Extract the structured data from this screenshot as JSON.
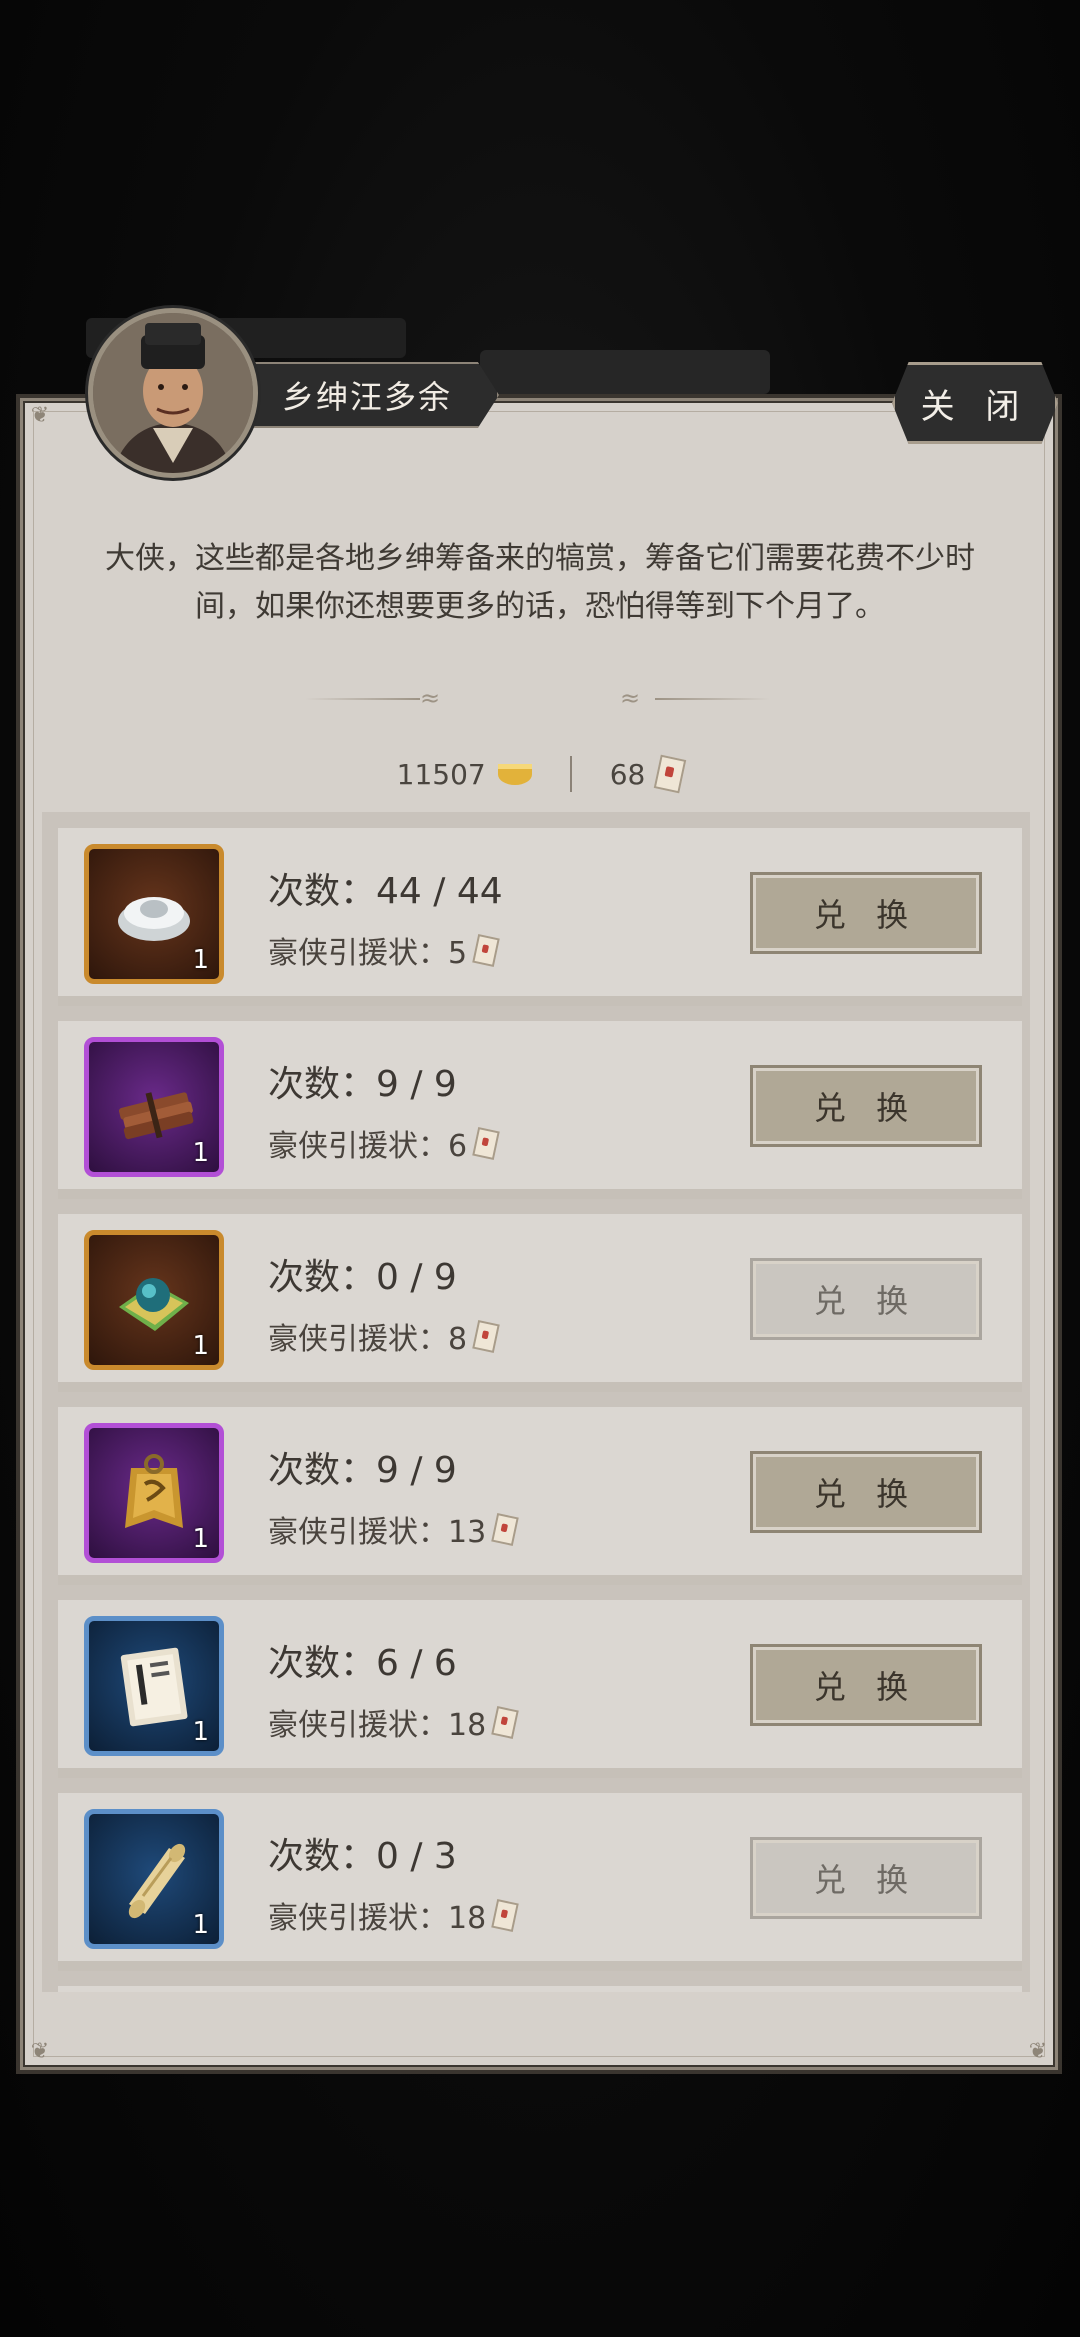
{
  "npc": {
    "name": "乡绅汪多余"
  },
  "close_label": "关 闭",
  "intro_text": "大侠，这些都是各地乡绅筹备来的犒赏，筹备它们需要花费不少时间，如果你还想要更多的话，恐怕得等到下个月了。",
  "currency": {
    "silver": "11507",
    "tickets": "68"
  },
  "items": [
    {
      "count": "次数：44 / 44",
      "cost": "豪侠引援状：5",
      "qty": "1",
      "button": "兑 换",
      "enabled": true,
      "rarity": "orange",
      "icon": "silver-ingot-icon"
    },
    {
      "count": "次数：9 / 9",
      "cost": "豪侠引援状：6",
      "qty": "1",
      "button": "兑 换",
      "enabled": true,
      "rarity": "purple",
      "icon": "wood-bundle-icon"
    },
    {
      "count": "次数：0 / 9",
      "cost": "豪侠引援状：8",
      "qty": "1",
      "button": "兑 换",
      "enabled": false,
      "rarity": "orange",
      "icon": "jade-orb-icon"
    },
    {
      "count": "次数：9 / 9",
      "cost": "豪侠引援状：13",
      "qty": "1",
      "button": "兑 换",
      "enabled": true,
      "rarity": "purple",
      "icon": "bronze-token-icon"
    },
    {
      "count": "次数：6 / 6",
      "cost": "豪侠引援状：18",
      "qty": "1",
      "button": "兑 换",
      "enabled": true,
      "rarity": "blue",
      "icon": "manual-book-icon"
    },
    {
      "count": "次数：0 / 3",
      "cost": "豪侠引援状：18",
      "qty": "1",
      "button": "兑 换",
      "enabled": false,
      "rarity": "blue",
      "icon": "scroll-icon"
    }
  ],
  "colors": {
    "panel": "#d6d1cb",
    "orange_frame": "#c98a2d",
    "purple_frame": "#b24fd6",
    "blue_frame": "#5c8fc8"
  }
}
